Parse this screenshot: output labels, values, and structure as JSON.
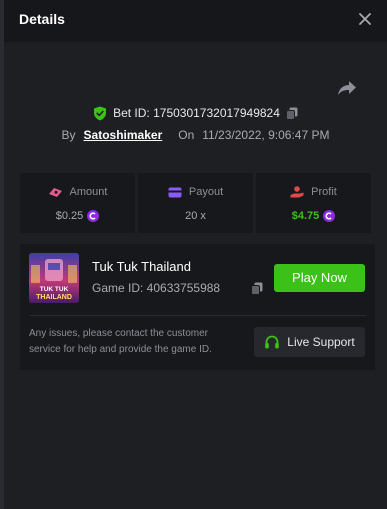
{
  "dialog": {
    "title": "Details",
    "close_icon": "close-icon",
    "share_icon": "share-icon"
  },
  "bet": {
    "id_label": "Bet ID: 1750301732017949824",
    "verified_icon": "shield-check-icon",
    "copy_icon": "copy-icon",
    "by_label": "By",
    "username": "Satoshimaker",
    "on_label": "On",
    "timestamp": "11/23/2022, 9:06:47 PM"
  },
  "stats": {
    "amount": {
      "label": "Amount",
      "value": "$0.25",
      "icon": "bet-chip-icon",
      "color": "#e35a8e"
    },
    "payout": {
      "label": "Payout",
      "value": "20 x",
      "icon": "card-icon",
      "color": "#8a5cf6"
    },
    "profit": {
      "label": "Profit",
      "value": "$4.75",
      "icon": "profit-hand-icon",
      "color": "#e34848",
      "value_color": "#3bc117"
    }
  },
  "coin_icon": "coin-icon",
  "coin_color": "#8b2be2",
  "game": {
    "name": "Tuk Tuk Thailand",
    "id_text": "Game ID: 40633755988",
    "thumb_title_top": "TUK TUK",
    "thumb_title_bottom": "THAILAND",
    "play_label": "Play Now",
    "play_color": "#3bc117"
  },
  "support": {
    "note": "Any issues, please contact the customer service for help and provide the game ID.",
    "button_label": "Live Support",
    "headset_color": "#3bc117"
  }
}
